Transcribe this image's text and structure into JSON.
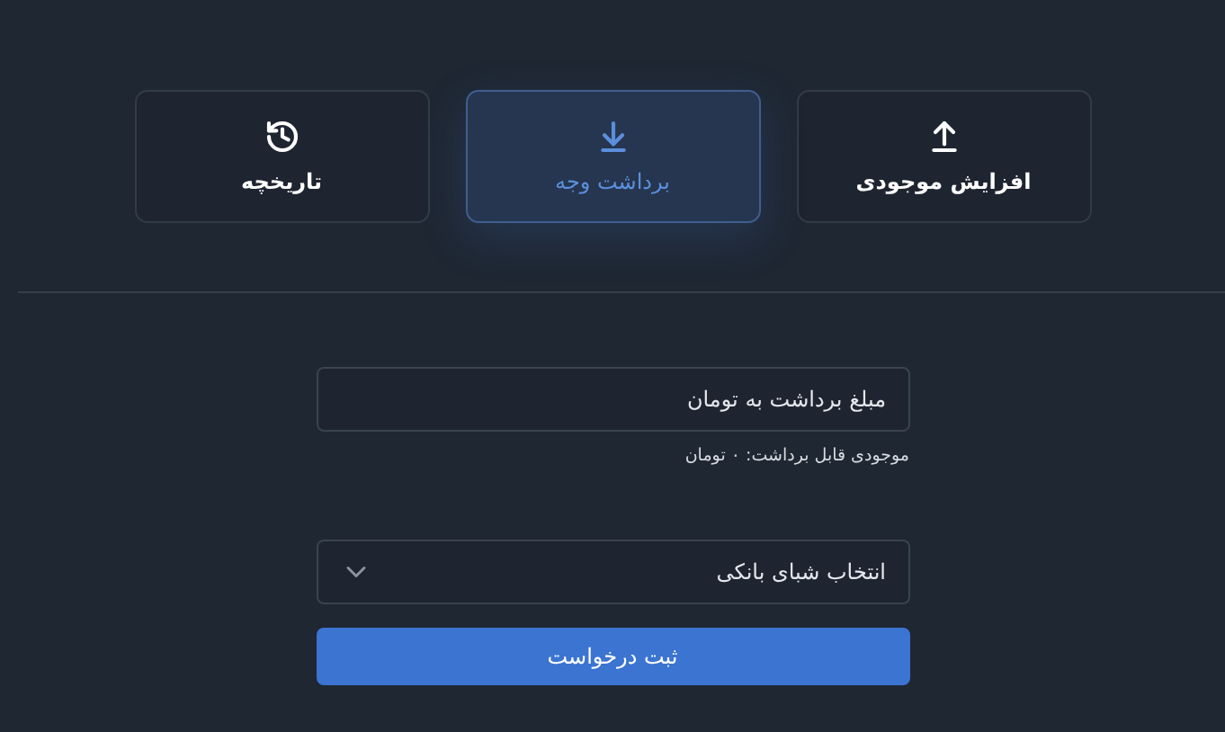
{
  "tabs": [
    {
      "label": "افزایش موجودی",
      "kind": "deposit",
      "selected": false
    },
    {
      "label": "برداشت وجه",
      "kind": "withdraw",
      "selected": true
    },
    {
      "label": "تاریخچه",
      "kind": "history",
      "selected": false
    }
  ],
  "amount_field": {
    "placeholder": "مبلغ برداشت به تومان"
  },
  "balance_hint": "موجودی قابل برداشت: ۰ تومان",
  "sheba_select": {
    "placeholder": "انتخاب شبای بانکی"
  },
  "submit_button": "ثبت درخواست"
}
